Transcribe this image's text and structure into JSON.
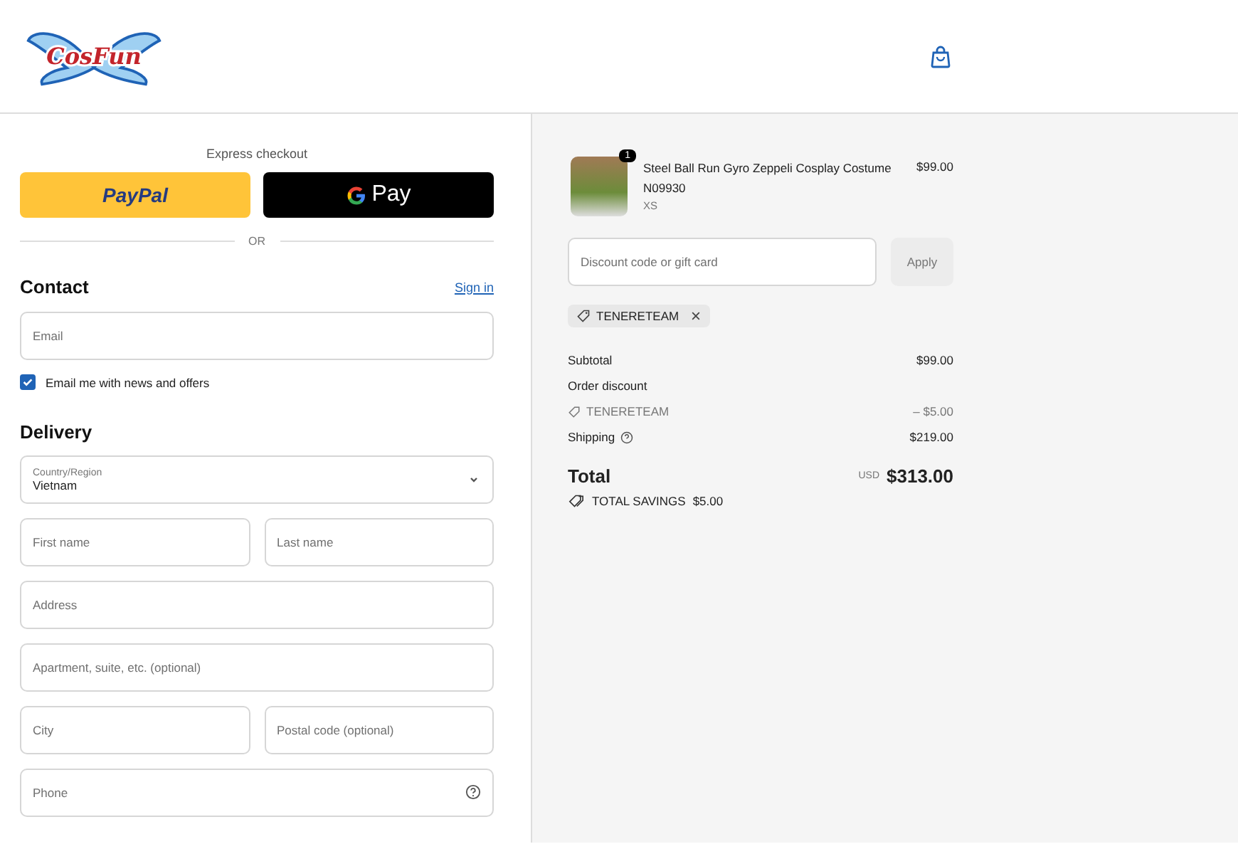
{
  "header": {
    "logo": "CosFun"
  },
  "express": {
    "title": "Express checkout",
    "buttons": [
      {
        "kind": "paypal",
        "label": "PayPal"
      },
      {
        "kind": "gpay",
        "label": "Pay"
      }
    ],
    "divider": "OR"
  },
  "contact": {
    "title": "Contact",
    "link": "Sign in",
    "email": {
      "placeholder": "Email"
    },
    "newsletter": {
      "label": "Email me with news and offers",
      "checked": true
    }
  },
  "delivery": {
    "title": "Delivery",
    "rows": [
      [
        {
          "kind": "select",
          "label": "Country/Region",
          "value": "Vietnam"
        }
      ],
      [
        {
          "kind": "text",
          "placeholder": "First name"
        },
        {
          "kind": "text",
          "placeholder": "Last name"
        }
      ],
      [
        {
          "kind": "text",
          "placeholder": "Address"
        }
      ],
      [
        {
          "kind": "text",
          "placeholder": "Apartment, suite, etc. (optional)"
        }
      ],
      [
        {
          "kind": "text",
          "placeholder": "City"
        },
        {
          "kind": "text",
          "placeholder": "Postal code (optional)"
        }
      ],
      [
        {
          "kind": "help",
          "placeholder": "Phone"
        }
      ]
    ]
  },
  "summary": {
    "item": {
      "name": "Steel Ball Run Gyro Zeppeli Cosplay Costume N09930",
      "variant": "XS",
      "quantity": "1",
      "price": "$99.00"
    },
    "discount": {
      "placeholder": "Discount code or gift card",
      "button": "Apply"
    },
    "applied_code": "TENERETEAM",
    "lines": [
      {
        "kind": "plain",
        "label": "Subtotal",
        "value": "$99.00"
      },
      {
        "kind": "heading",
        "label": "Order discount"
      },
      {
        "kind": "code",
        "label": "TENERETEAM",
        "value": "– $5.00"
      },
      {
        "kind": "help",
        "label": "Shipping",
        "value": "$219.00"
      }
    ],
    "total": {
      "label": "Total",
      "currency": "USD",
      "value": "$313.00"
    },
    "savings": {
      "label": "TOTAL SAVINGS",
      "value": "$5.00"
    }
  }
}
